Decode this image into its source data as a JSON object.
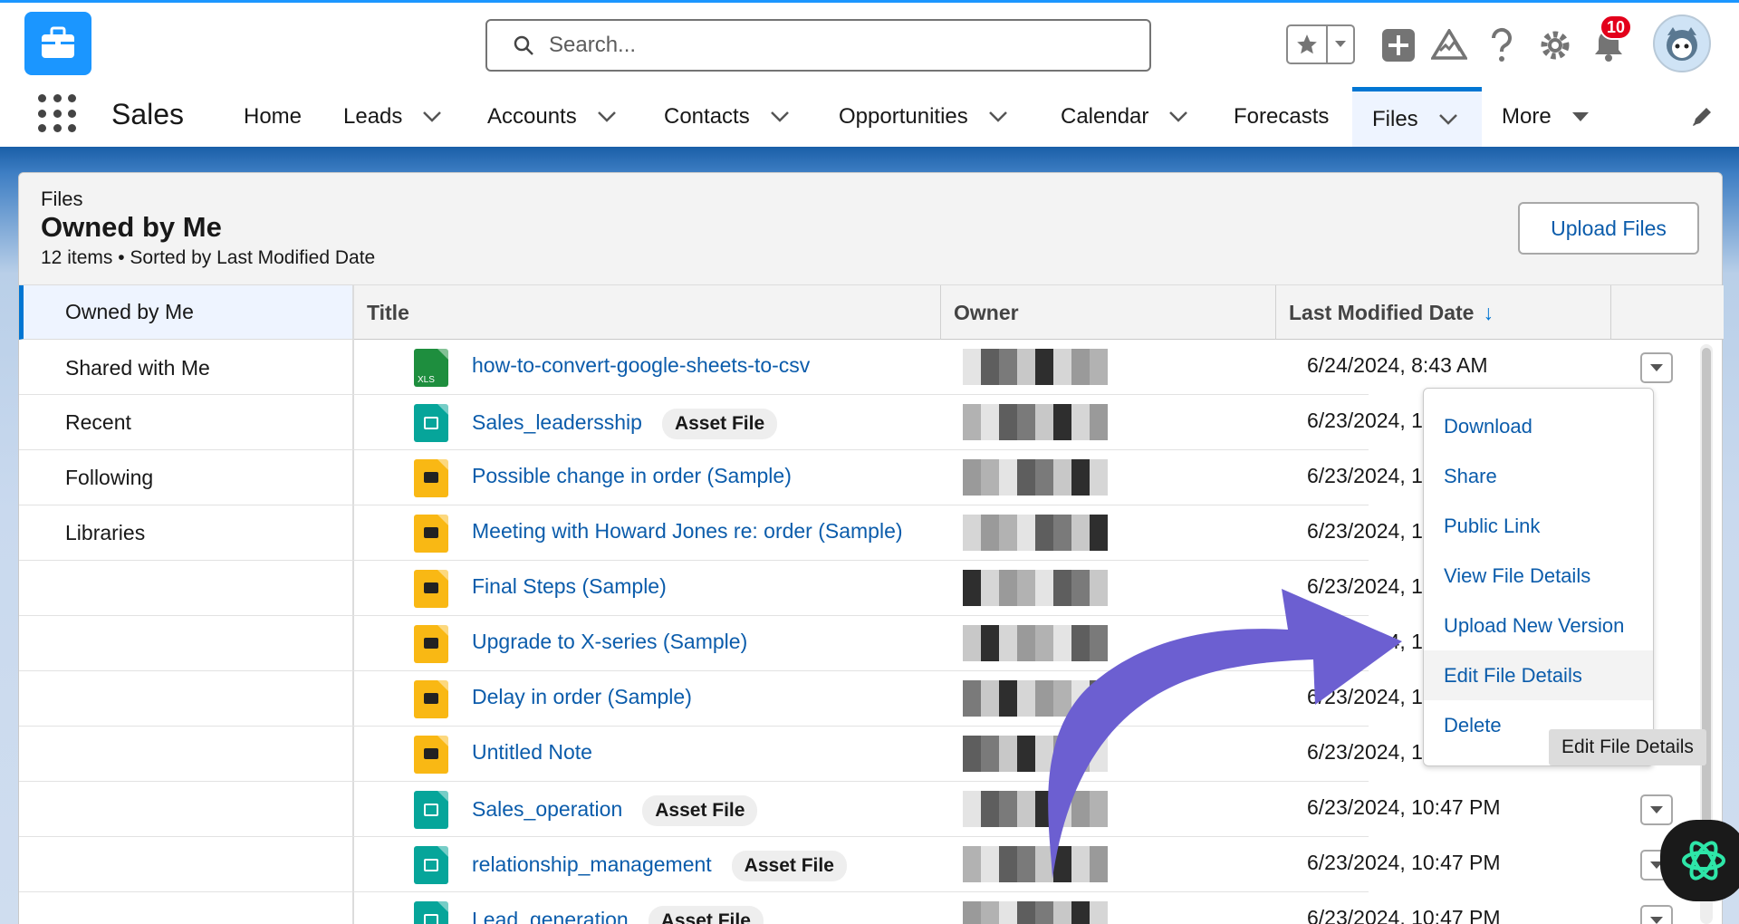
{
  "header": {
    "search_placeholder": "Search...",
    "notification_count": "10"
  },
  "nav": {
    "app_name": "Sales",
    "items": [
      {
        "label": "Home"
      },
      {
        "label": "Leads"
      },
      {
        "label": "Accounts"
      },
      {
        "label": "Contacts"
      },
      {
        "label": "Opportunities"
      },
      {
        "label": "Calendar"
      },
      {
        "label": "Forecasts"
      },
      {
        "label": "Files"
      },
      {
        "label": "More"
      }
    ]
  },
  "page": {
    "kicker": "Files",
    "title": "Owned by Me",
    "meta": "12 items • Sorted by Last Modified Date",
    "upload_label": "Upload Files"
  },
  "sidenav": [
    "Owned by Me",
    "Shared with Me",
    "Recent",
    "Following",
    "Libraries"
  ],
  "table": {
    "columns": [
      "Title",
      "Owner",
      "Last Modified Date"
    ],
    "sort_indicator": "↓",
    "rows": [
      {
        "title": "how-to-convert-google-sheets-to-csv",
        "type": "xls",
        "tag": "",
        "date": "6/24/2024, 8:43 AM"
      },
      {
        "title": "Sales_leadersship",
        "type": "img",
        "tag": "Asset File",
        "date": "6/23/2024, 10"
      },
      {
        "title": "Possible change in order (Sample)",
        "type": "note",
        "tag": "",
        "date": "6/23/2024, 10"
      },
      {
        "title": "Meeting with Howard Jones re: order (Sample)",
        "type": "note",
        "tag": "",
        "date": "6/23/2024, 10"
      },
      {
        "title": "Final Steps (Sample)",
        "type": "note",
        "tag": "",
        "date": "6/23/2024, 10"
      },
      {
        "title": "Upgrade to X-series (Sample)",
        "type": "note",
        "tag": "",
        "date": "6/23/2024, 10"
      },
      {
        "title": "Delay in order (Sample)",
        "type": "note",
        "tag": "",
        "date": "6/23/2024, 10"
      },
      {
        "title": "Untitled Note",
        "type": "note",
        "tag": "",
        "date": "6/23/2024, 10"
      },
      {
        "title": "Sales_operation",
        "type": "img",
        "tag": "Asset File",
        "date": "6/23/2024, 10:47 PM"
      },
      {
        "title": "relationship_management",
        "type": "img",
        "tag": "Asset File",
        "date": "6/23/2024, 10:47 PM"
      },
      {
        "title": "Lead_generation",
        "type": "img",
        "tag": "Asset File",
        "date": "6/23/2024, 10:47 PM"
      }
    ]
  },
  "row_menu": {
    "items": [
      "Download",
      "Share",
      "Public Link",
      "View File Details",
      "Upload New Version",
      "Edit File Details",
      "Delete"
    ],
    "hovered": "Edit File Details"
  },
  "tooltip": "Edit File Details",
  "colors": {
    "brand": "#0176d3",
    "link": "#0b5cab",
    "annotation_arrow": "#6c5fd1",
    "notification_badge": "#e3001b"
  },
  "icons": {
    "xls": "spreadsheet-file-icon",
    "img": "image-file-icon",
    "note": "note-file-icon"
  }
}
